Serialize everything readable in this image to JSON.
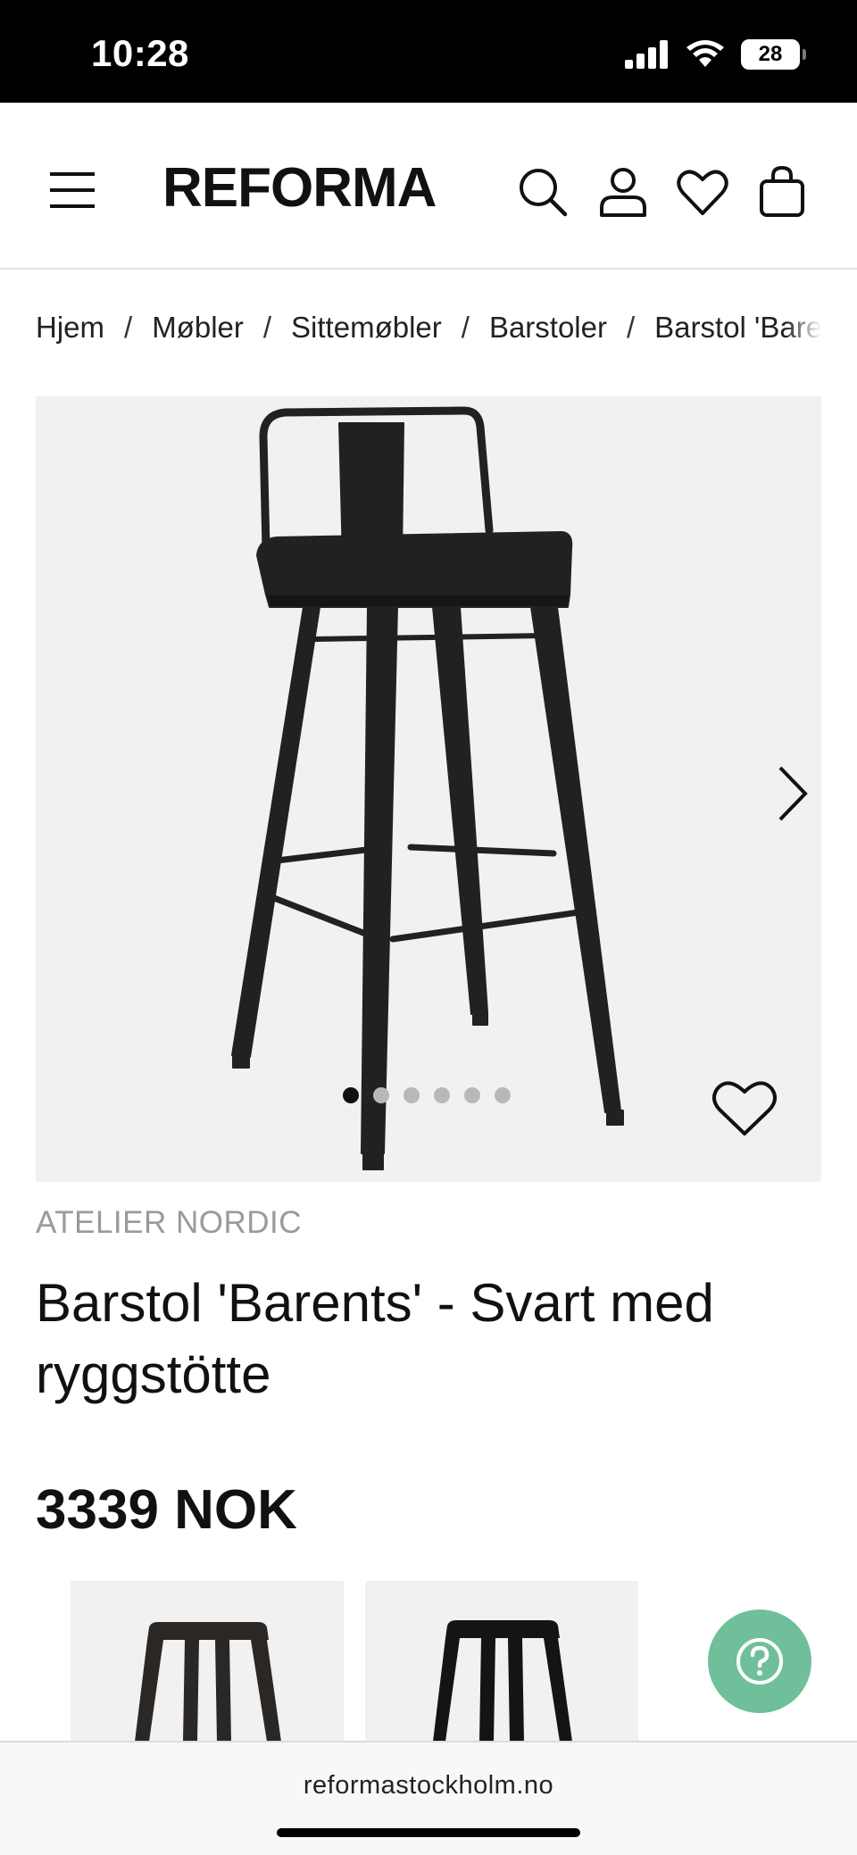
{
  "status_bar": {
    "time": "10:28",
    "battery": "28"
  },
  "header": {
    "brand": "REFORMA"
  },
  "breadcrumb": [
    "Hjem",
    "Møbler",
    "Sittemøbler",
    "Barstoler",
    "Barstol 'Barents' - Svart med ryggstötte"
  ],
  "breadcrumb_separator": "/",
  "gallery": {
    "image_count": 6,
    "active_index": 0
  },
  "product": {
    "brand": "ATELIER NORDIC",
    "title": "Barstol 'Barents' - Svart med ryggstötte",
    "price": "3339 NOK"
  },
  "browser": {
    "url": "reformastockholm.no"
  },
  "colors": {
    "help_button": "#6fbf9b",
    "image_bg": "#f1f1f1",
    "brand_grey": "#9a9a9a"
  },
  "icons": [
    "menu-icon",
    "search-icon",
    "account-icon",
    "wishlist-icon",
    "cart-icon",
    "chevron-right-icon",
    "heart-icon",
    "help-icon"
  ]
}
